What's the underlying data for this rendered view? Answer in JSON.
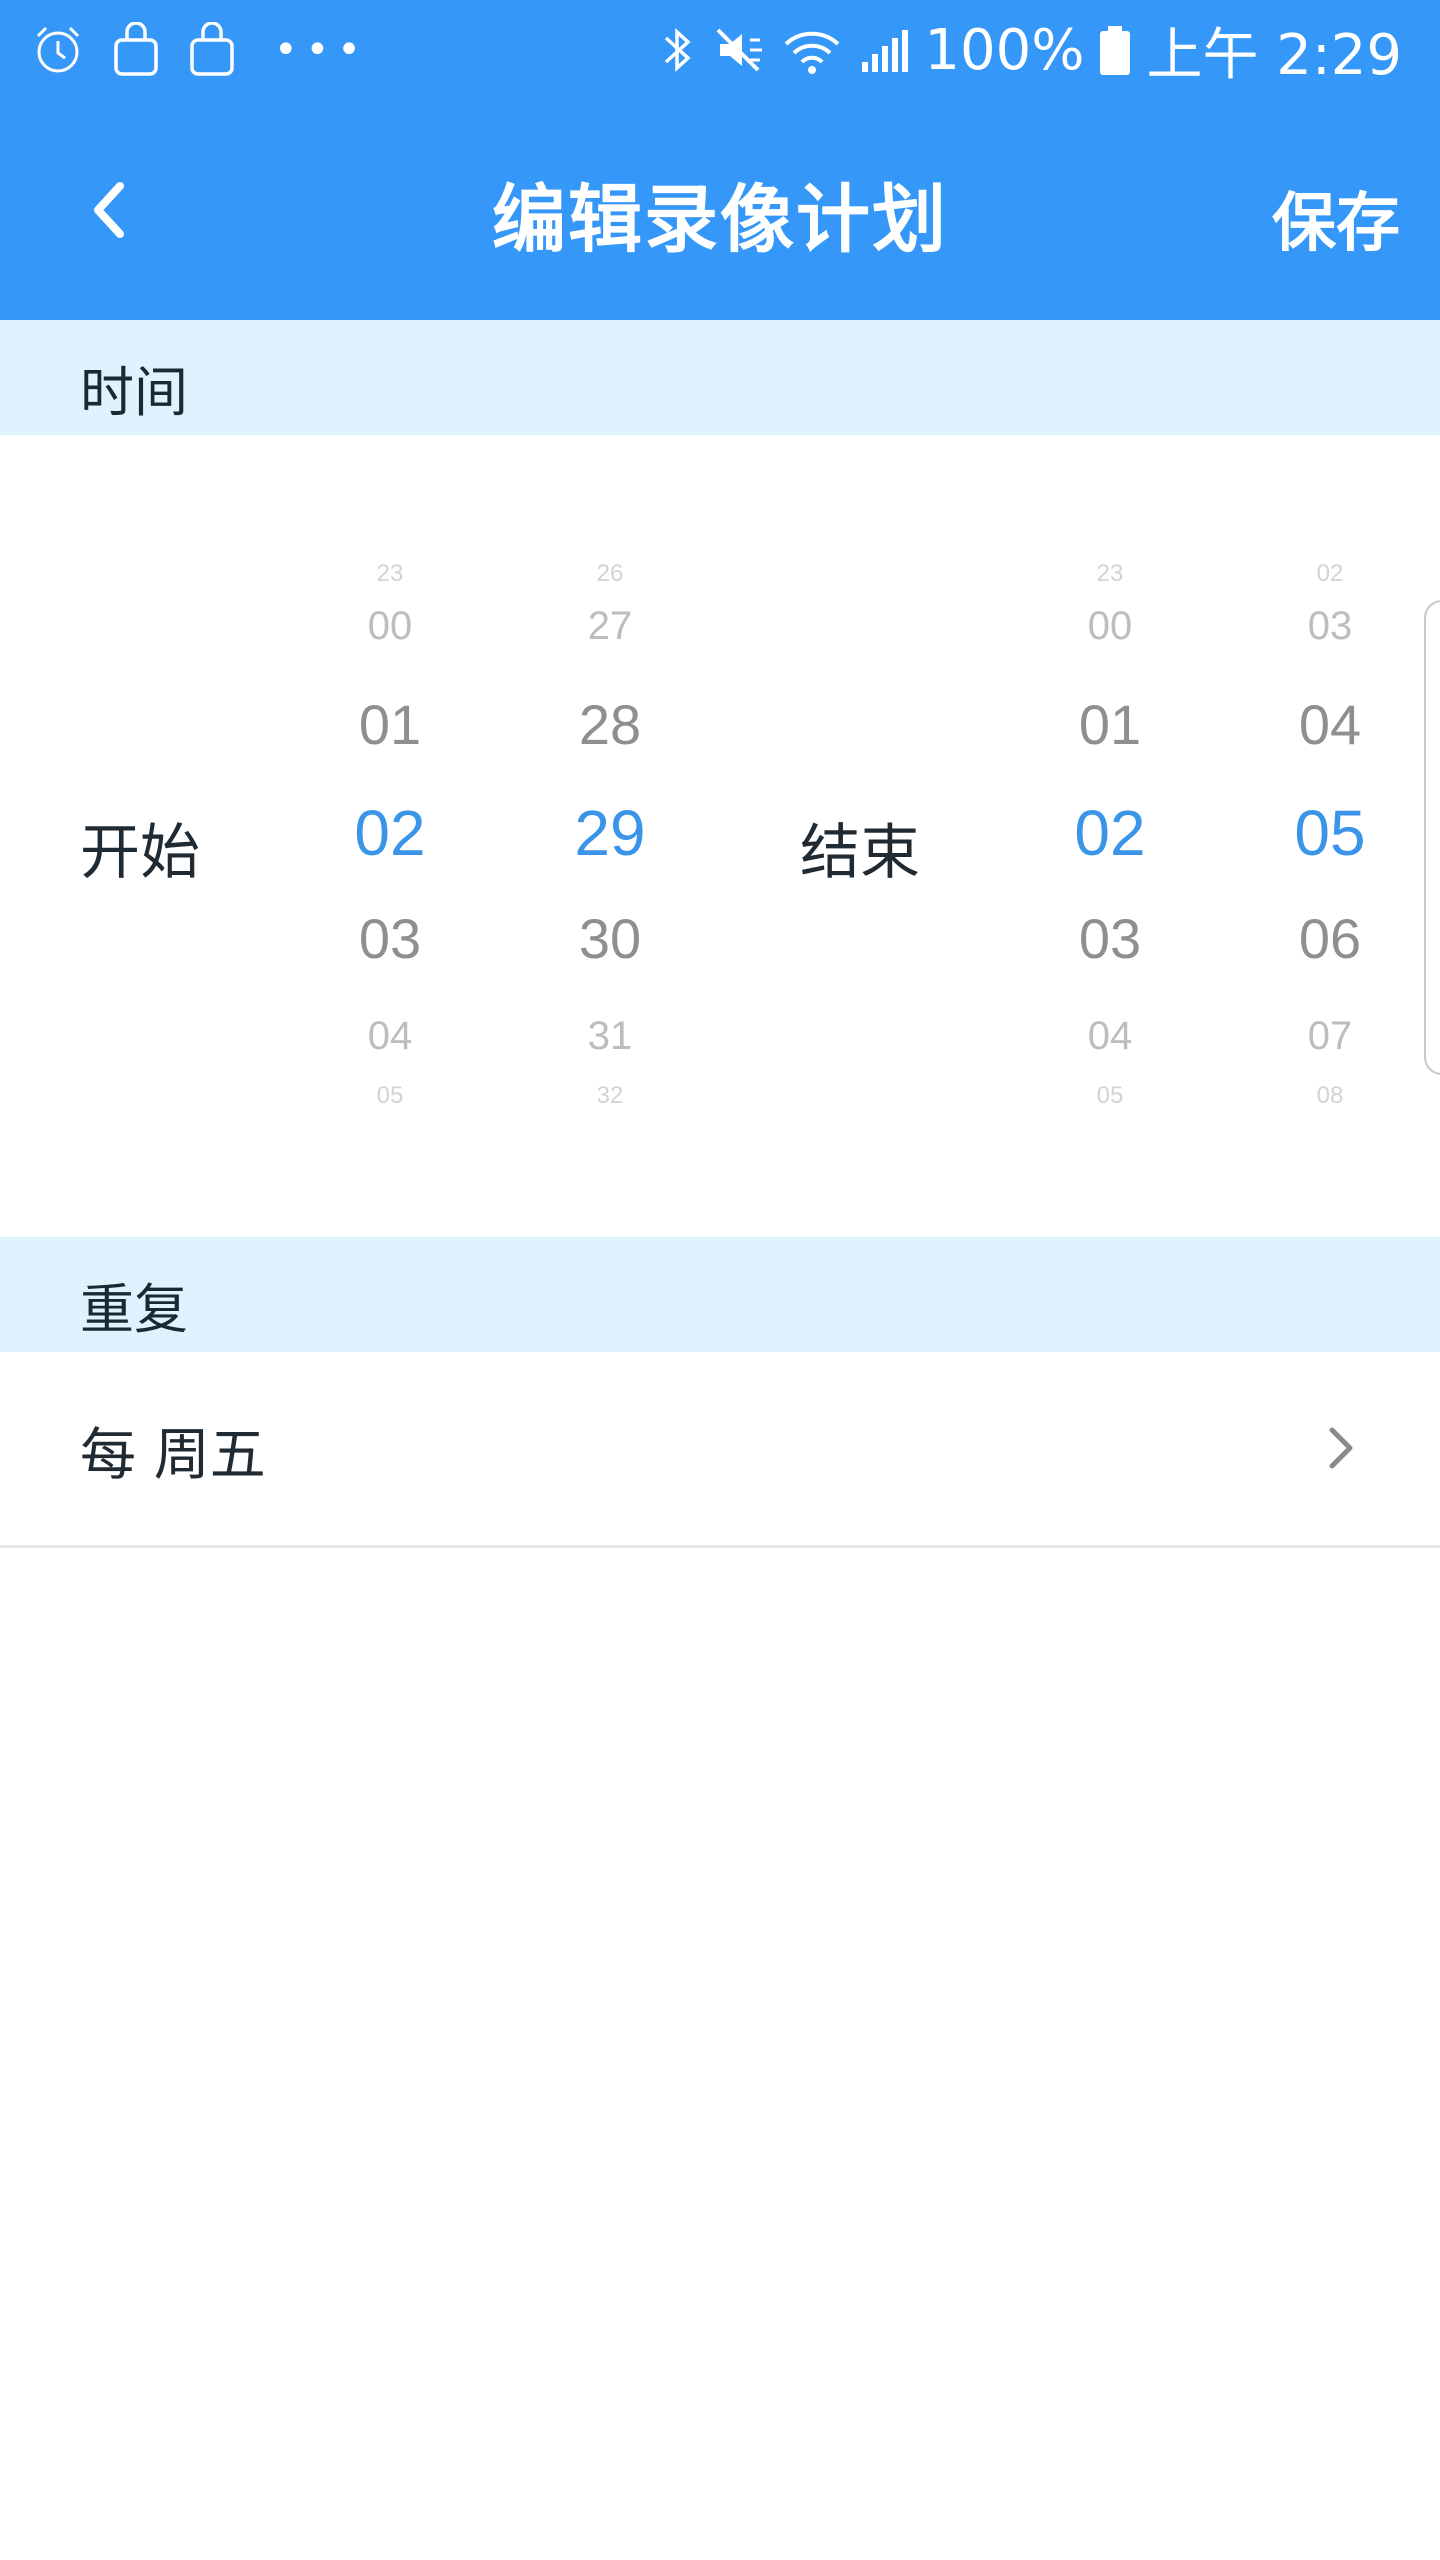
{
  "status_bar": {
    "battery": "100%",
    "time": "上午 2:29",
    "icons": [
      "alarm-icon",
      "bag-icon",
      "bag-icon",
      "more-dots-icon",
      "bluetooth-icon",
      "mute-icon",
      "wifi-icon",
      "signal-icon",
      "battery-icon"
    ]
  },
  "app_bar": {
    "title": "编辑录像计划",
    "save_label": "保存",
    "back_icon": "chevron-left-icon"
  },
  "time_section": {
    "header": "时间",
    "start_label": "开始",
    "end_label": "结束",
    "start_hour": {
      "items": [
        "23",
        "00",
        "01",
        "02",
        "03",
        "04",
        "05"
      ],
      "selected": "02"
    },
    "start_minute": {
      "items": [
        "26",
        "27",
        "28",
        "29",
        "30",
        "31",
        "32"
      ],
      "selected": "29"
    },
    "end_hour": {
      "items": [
        "23",
        "00",
        "01",
        "02",
        "03",
        "04",
        "05"
      ],
      "selected": "02"
    },
    "end_minute": {
      "items": [
        "02",
        "03",
        "04",
        "05",
        "06",
        "07",
        "08"
      ],
      "selected": "05"
    }
  },
  "repeat_section": {
    "header": "重复",
    "value": "每 周五"
  },
  "colors": {
    "primary": "#3597f7",
    "section_bg": "#e0f2fd",
    "selected_text": "#3a95e8"
  }
}
